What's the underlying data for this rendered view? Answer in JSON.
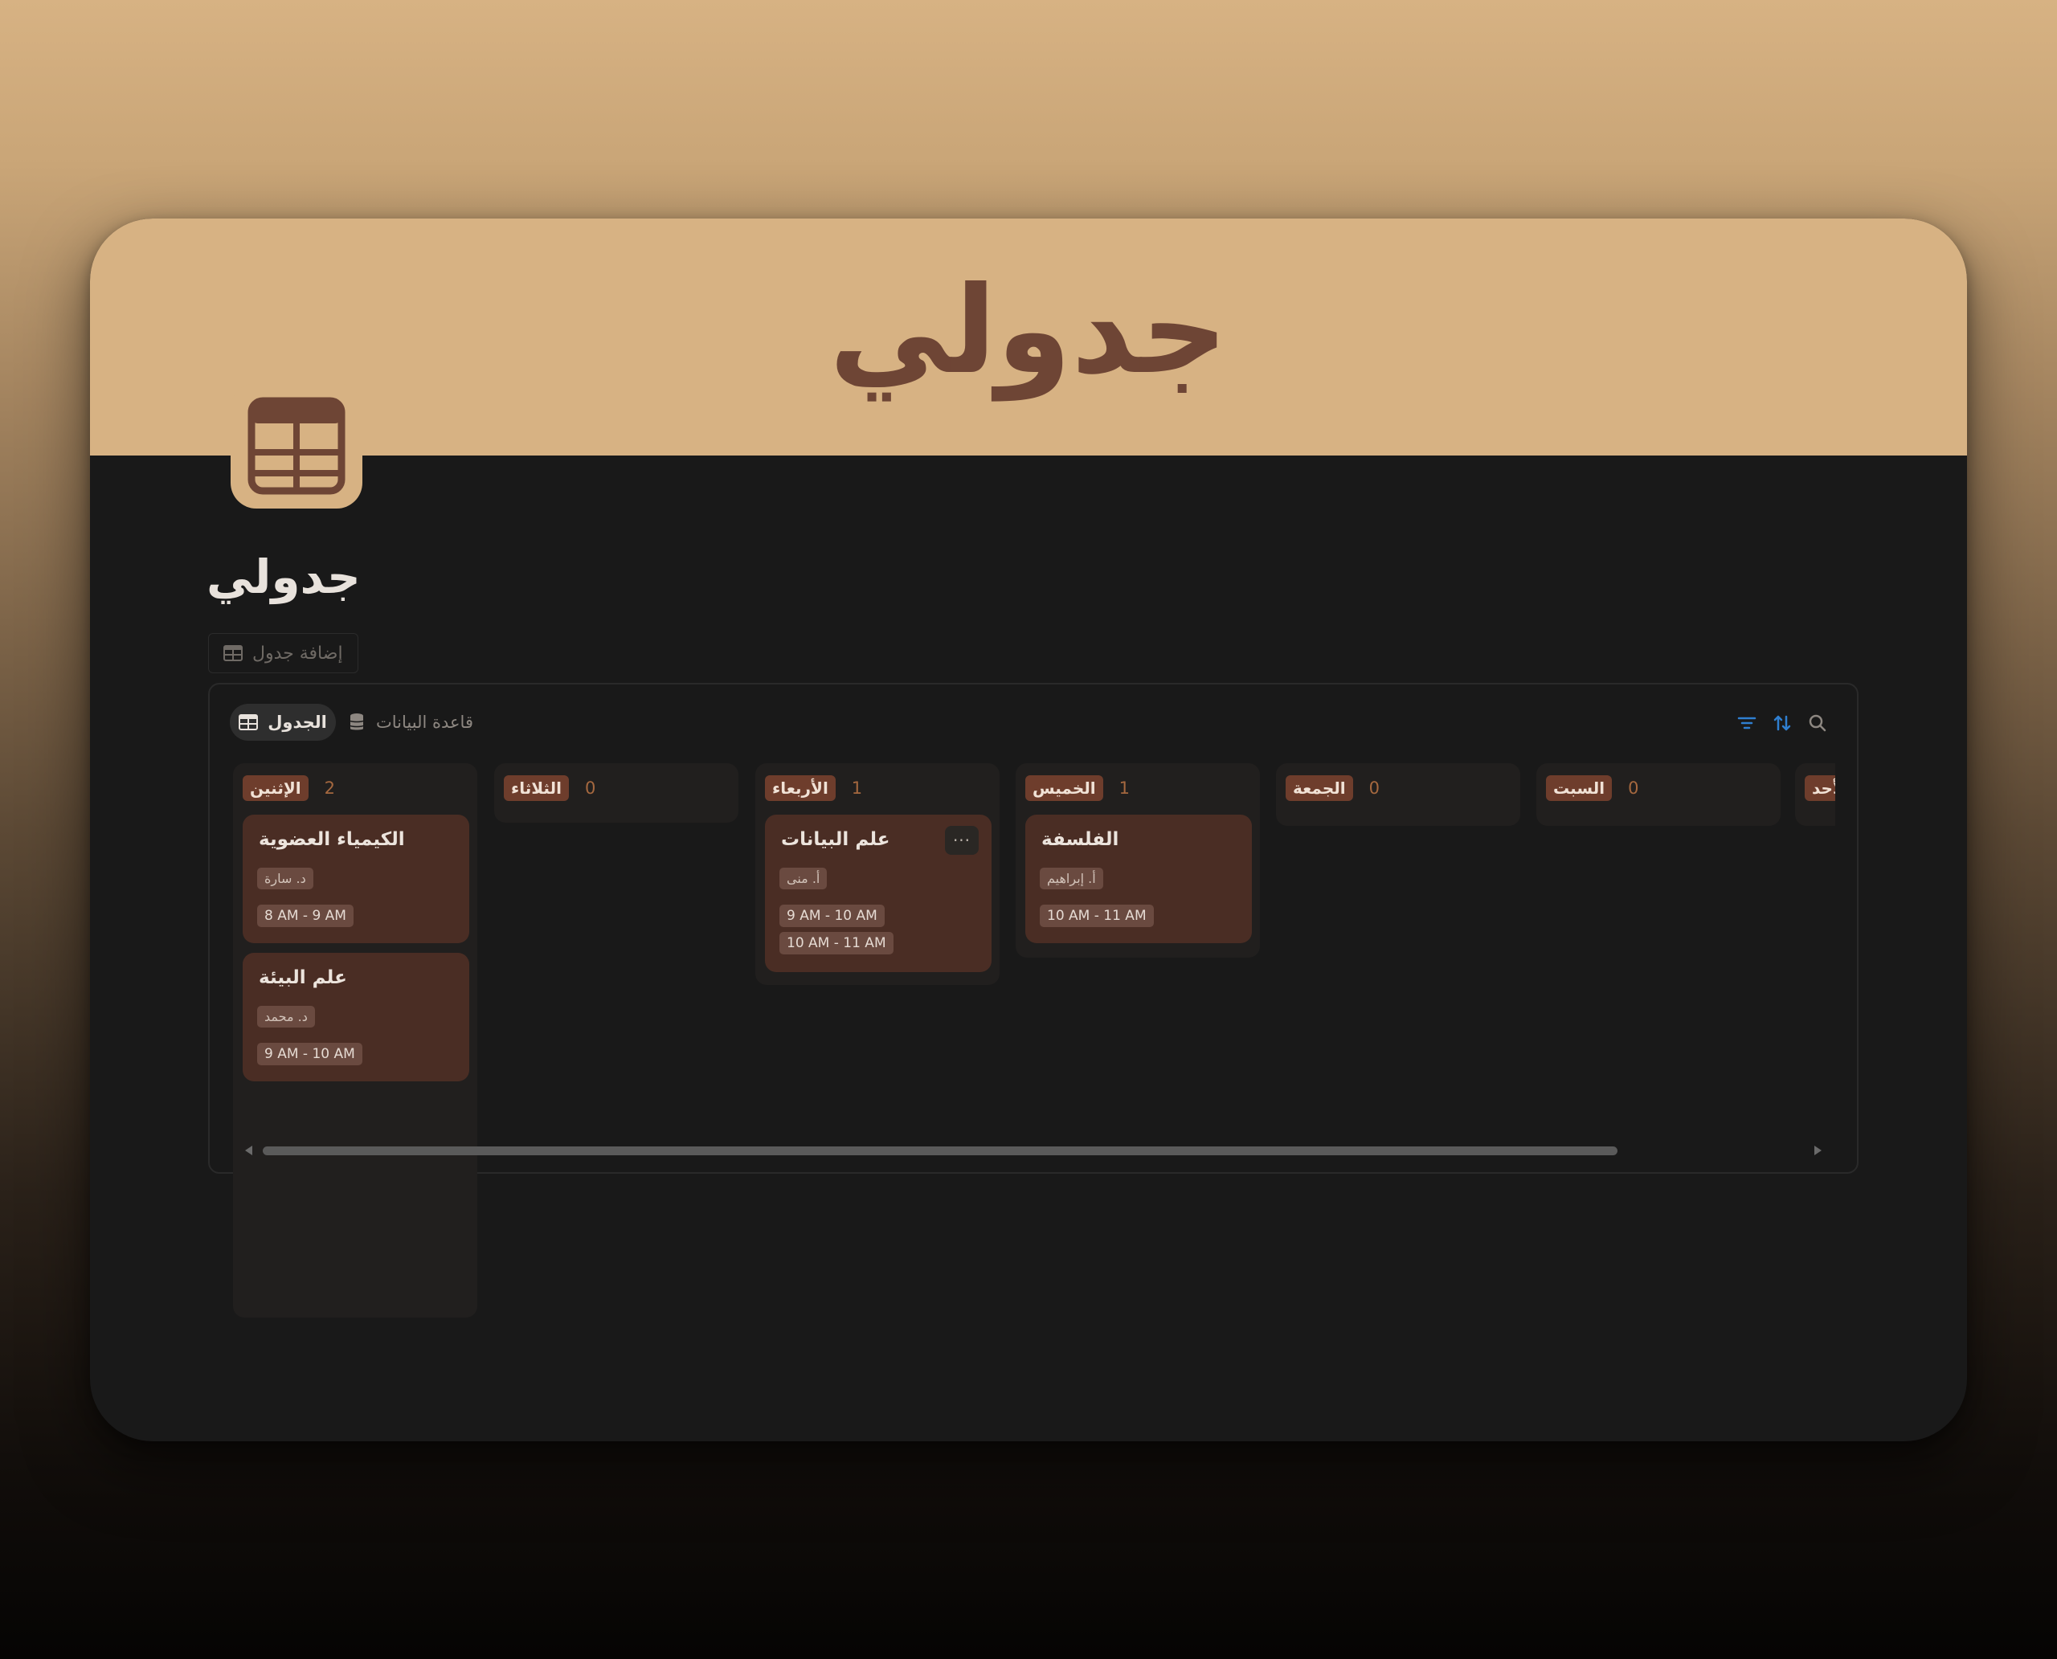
{
  "banner": {
    "title": "جدولي"
  },
  "page": {
    "title": "جدولي",
    "add_table_label": "إضافة جدول"
  },
  "views": {
    "active_tab": "الجدول",
    "other_tab": "قاعدة البيانات"
  },
  "toolbar": {
    "icons": [
      "filter-icon",
      "sort-icon",
      "search-icon"
    ],
    "accent": "#2f7fd0"
  },
  "board": {
    "columns": [
      {
        "day": "الإثنين",
        "count": "2"
      },
      {
        "day": "الثلاثاء",
        "count": "0"
      },
      {
        "day": "الأربعاء",
        "count": "1"
      },
      {
        "day": "الخميس",
        "count": "1"
      },
      {
        "day": "الجمعة",
        "count": "0"
      },
      {
        "day": "السبت",
        "count": "0"
      },
      {
        "day": "الأحد",
        "count": ""
      }
    ],
    "cards": [
      {
        "title": "الكيمياء العضوية",
        "professor": "د. سارة",
        "times": [
          "8 AM - 9 AM"
        ]
      },
      {
        "title": "علم البيئة",
        "professor": "د. محمد",
        "times": [
          "9 AM - 10 AM"
        ]
      },
      {
        "title": "علم البيانات",
        "professor": "أ. منى",
        "times": [
          "9 AM - 10 AM",
          "10 AM - 11 AM"
        ]
      },
      {
        "title": "الفلسفة",
        "professor": "أ. إبراهيم",
        "times": [
          "10 AM - 11 AM"
        ]
      }
    ],
    "more_label": "···"
  },
  "colors": {
    "banner": "#d7b283",
    "dark_bg": "#191919",
    "card": "#4a2d24",
    "tag": "#6e3d2c"
  }
}
